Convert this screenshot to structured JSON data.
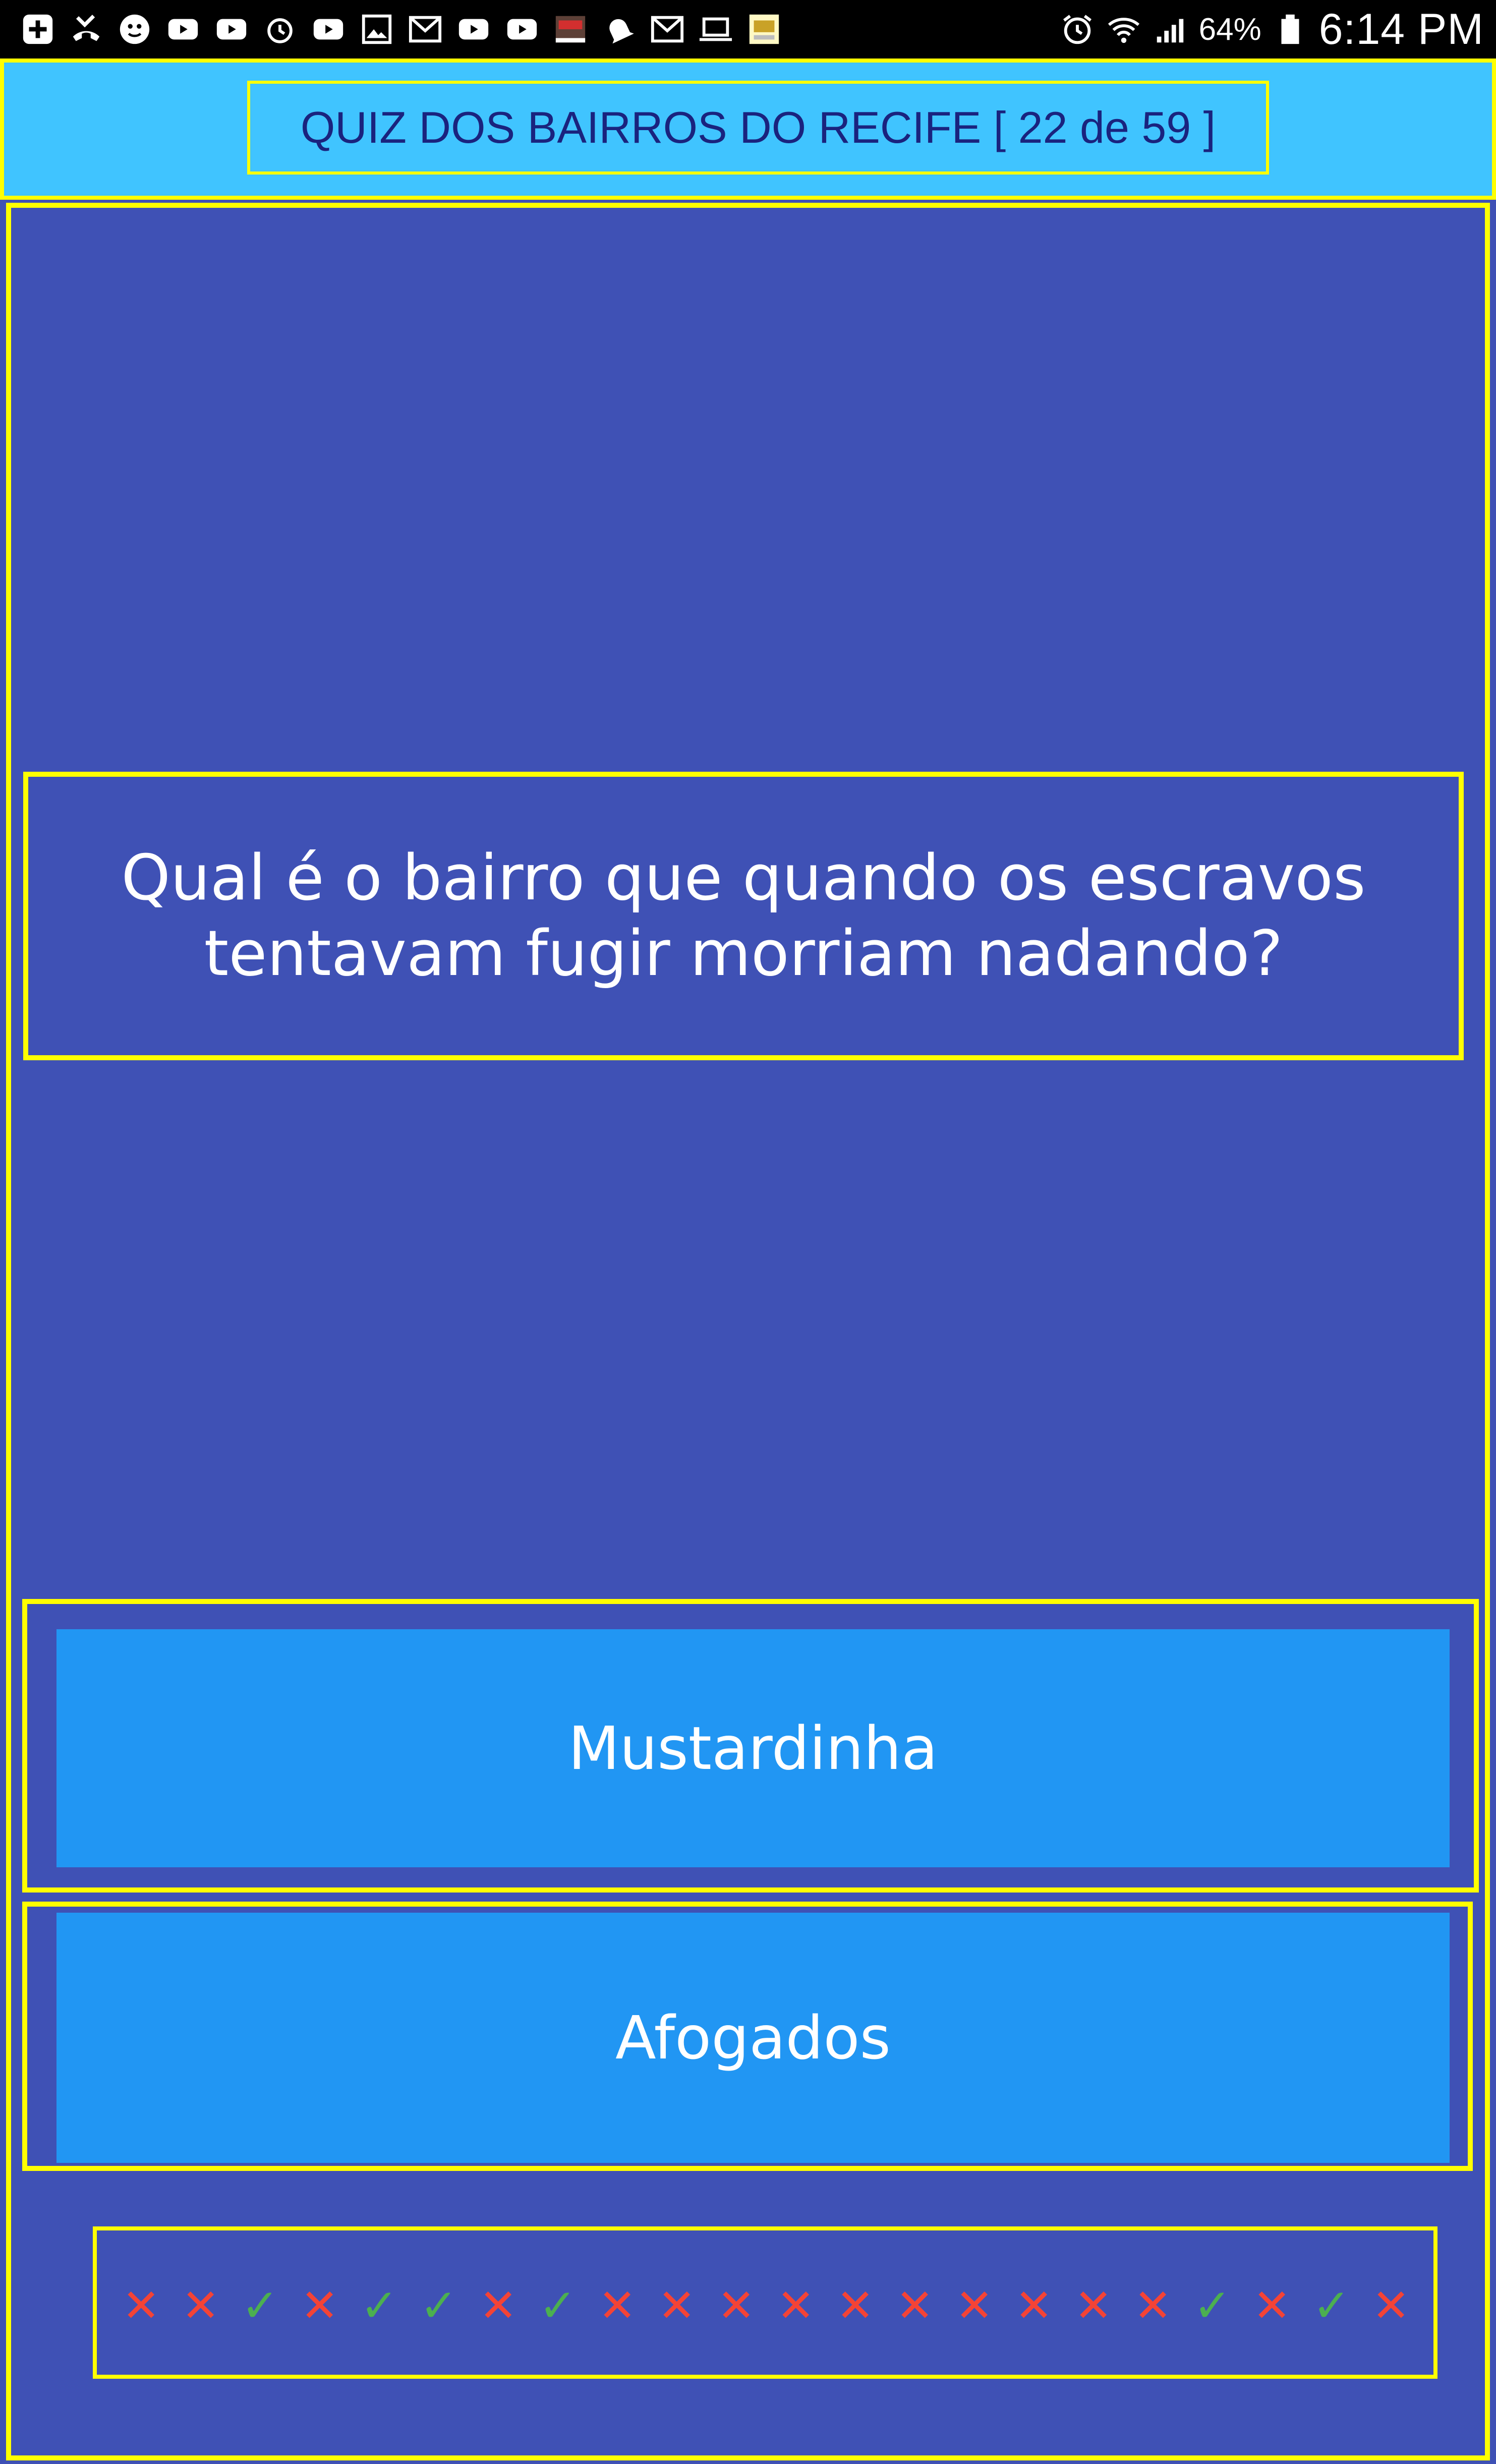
{
  "status_bar": {
    "left_icons": [
      "add-box-icon",
      "missed-call-icon",
      "face-icon",
      "youtube-icon",
      "youtube-icon",
      "alarm-icon",
      "youtube-icon",
      "photo-icon",
      "gmail-icon",
      "youtube-icon",
      "youtube-icon",
      "app-thumbnail-icon",
      "notification-bell-icon",
      "gmail-icon",
      "laptop-icon",
      "app-thumbnail-icon"
    ],
    "battery_percent": "64%",
    "time": "6:14 PM"
  },
  "header": {
    "title": "QUIZ DOS BAIRROS DO RECIFE [ 22 de 59 ]"
  },
  "question": {
    "text": "Qual é o bairro que quando os escravos tentavam fugir morriam nadando?"
  },
  "answers": [
    {
      "label": "Mustardinha"
    },
    {
      "label": "Afogados"
    }
  ],
  "results": {
    "marks": [
      "wrong",
      "wrong",
      "right",
      "wrong",
      "right",
      "right",
      "wrong",
      "right",
      "wrong",
      "wrong",
      "wrong",
      "wrong",
      "wrong",
      "wrong",
      "wrong",
      "wrong",
      "wrong",
      "wrong",
      "right",
      "wrong",
      "right",
      "wrong"
    ],
    "symbols": {
      "wrong": "✕",
      "right": "✓"
    },
    "colors": {
      "wrong": "#f44336",
      "right": "#4caf50"
    }
  },
  "colors": {
    "background": "#3f51b5",
    "header_background": "#40c4ff",
    "header_text": "#1a237e",
    "button_background": "#2196f3",
    "outline": "#ffff00"
  }
}
